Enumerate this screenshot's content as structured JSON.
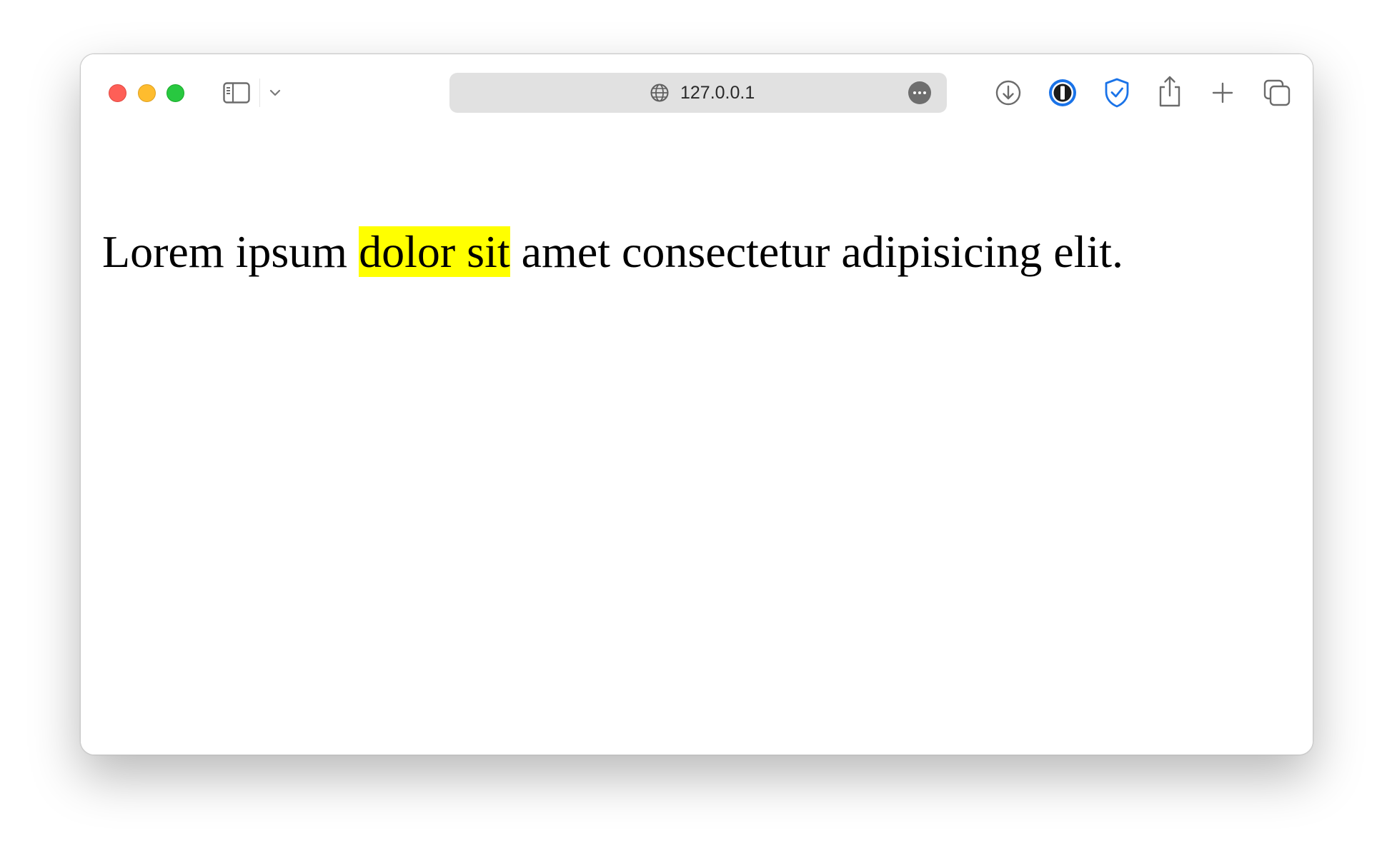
{
  "address_bar": {
    "url": "127.0.0.1"
  },
  "page": {
    "text_before": "Lorem ipsum ",
    "highlighted_text": "dolor sit",
    "text_after": " amet consectetur adipisicing elit."
  },
  "colors": {
    "highlight": "#ffff00",
    "close": "#fe5f57",
    "minimize": "#febc2e",
    "maximize": "#28c840",
    "accent_blue": "#1a73e8"
  },
  "icons": {
    "sidebar": "sidebar-icon",
    "chevron": "chevron-down-icon",
    "globe": "globe-icon",
    "more": "more-icon",
    "download": "download-icon",
    "password_manager": "password-manager-icon",
    "shield": "shield-check-icon",
    "share": "share-icon",
    "new_tab": "plus-icon",
    "tab_overview": "tab-overview-icon"
  }
}
